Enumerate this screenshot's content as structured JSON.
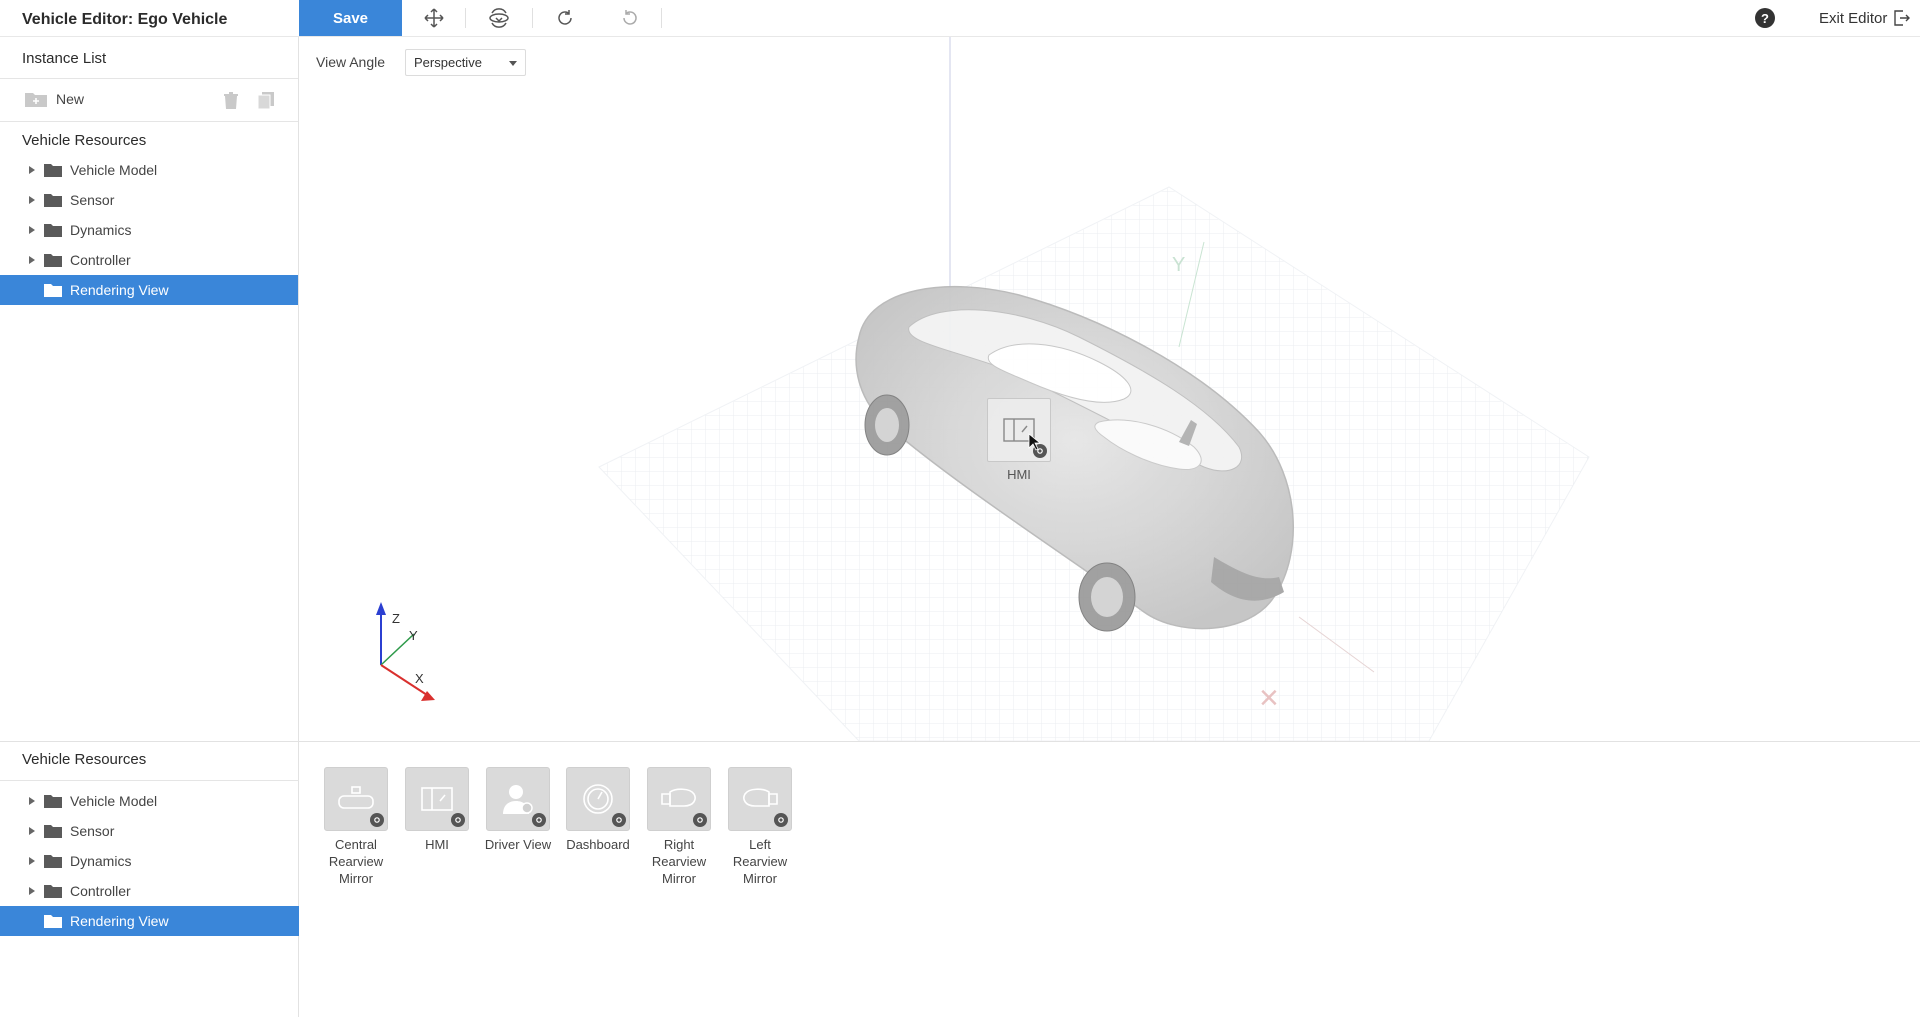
{
  "app": {
    "title": "Vehicle Editor: Ego Vehicle"
  },
  "toolbar": {
    "save_label": "Save",
    "tools": [
      "move-icon",
      "rotate-view-icon",
      "redo-icon",
      "undo-icon"
    ],
    "help_label": "?",
    "exit_label": "Exit Editor"
  },
  "instance_list": {
    "title": "Instance List",
    "new_label": "New"
  },
  "resources_top": {
    "title": "Vehicle Resources",
    "items": [
      {
        "label": "Vehicle Model",
        "expandable": true
      },
      {
        "label": "Sensor",
        "expandable": true
      },
      {
        "label": "Dynamics",
        "expandable": true
      },
      {
        "label": "Controller",
        "expandable": true
      },
      {
        "label": "Rendering View",
        "expandable": false,
        "selected": true
      }
    ]
  },
  "resources_bottom": {
    "title": "Vehicle Resources",
    "items": [
      {
        "label": "Vehicle Model",
        "expandable": true
      },
      {
        "label": "Sensor",
        "expandable": true
      },
      {
        "label": "Dynamics",
        "expandable": true
      },
      {
        "label": "Controller",
        "expandable": true
      },
      {
        "label": "Rendering View",
        "expandable": false,
        "selected": true
      }
    ]
  },
  "viewport": {
    "view_angle_label": "View Angle",
    "view_angle_value": "Perspective",
    "axis_labels": {
      "x": "X",
      "y": "Y",
      "z": "Z"
    },
    "marker_label": "HMI"
  },
  "rendering_views": [
    {
      "label_line1": "Central",
      "label_line2": "Rearview Mirror",
      "icon": "mirror-icon"
    },
    {
      "label_line1": "HMI",
      "label_line2": "",
      "icon": "screen-icon"
    },
    {
      "label_line1": "Driver View",
      "label_line2": "",
      "icon": "driver-icon"
    },
    {
      "label_line1": "Dashboard",
      "label_line2": "",
      "icon": "gauge-icon"
    },
    {
      "label_line1": "Right",
      "label_line2": "Rearview Mirror",
      "icon": "right-mirror-icon"
    },
    {
      "label_line1": "Left",
      "label_line2": "Rearview Mirror",
      "icon": "left-mirror-icon"
    }
  ],
  "colors": {
    "accent": "#3a86d9",
    "selected_bg": "#3a86d9",
    "axis_x": "#d9302e",
    "axis_y": "#2e9a4a",
    "axis_z": "#2b3fd1"
  }
}
